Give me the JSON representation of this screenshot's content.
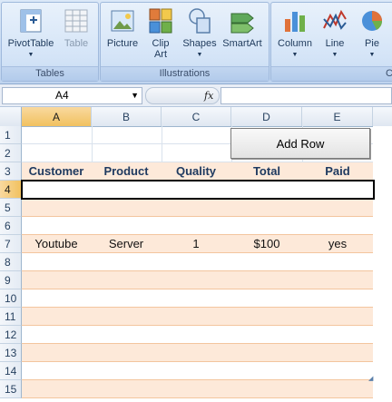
{
  "ribbon": {
    "groups": [
      {
        "label": "Tables",
        "buttons": [
          {
            "label": "PivotTable",
            "icon": "pivottable-icon",
            "dropdown": true,
            "enabled": true
          },
          {
            "label": "Table",
            "icon": "table-icon",
            "dropdown": false,
            "enabled": false
          }
        ]
      },
      {
        "label": "Illustrations",
        "buttons": [
          {
            "label": "Picture",
            "icon": "picture-icon",
            "enabled": true
          },
          {
            "label": "Clip Art",
            "icon": "clipart-icon",
            "enabled": true
          },
          {
            "label": "Shapes",
            "icon": "shapes-icon",
            "dropdown": true,
            "enabled": true
          },
          {
            "label": "SmartArt",
            "icon": "smartart-icon",
            "enabled": true
          }
        ]
      },
      {
        "label": "C",
        "buttons": [
          {
            "label": "Column",
            "icon": "column-chart-icon",
            "dropdown": true,
            "enabled": true
          },
          {
            "label": "Line",
            "icon": "line-chart-icon",
            "dropdown": true,
            "enabled": true
          },
          {
            "label": "Pie",
            "icon": "pie-chart-icon",
            "dropdown": true,
            "enabled": true
          }
        ]
      }
    ]
  },
  "formula_bar": {
    "name_box": "A4",
    "fx": "fx",
    "value": ""
  },
  "columns": [
    "A",
    "B",
    "C",
    "D",
    "E"
  ],
  "selected_column": "A",
  "rows": [
    "1",
    "2",
    "3",
    "4",
    "5",
    "6",
    "7",
    "8",
    "9",
    "10",
    "11",
    "12",
    "13",
    "14",
    "15"
  ],
  "selected_row": "4",
  "table": {
    "headers": [
      "Customer",
      "Product",
      "Quality",
      "Total",
      "Paid"
    ],
    "data_row": [
      "Youtube",
      "Server",
      "1",
      "$100",
      "yes"
    ]
  },
  "add_row_button": "Add Row",
  "colors": {
    "band": "#fde9d9",
    "selection": "#f1c15f",
    "header_text": "#1f3a60"
  }
}
